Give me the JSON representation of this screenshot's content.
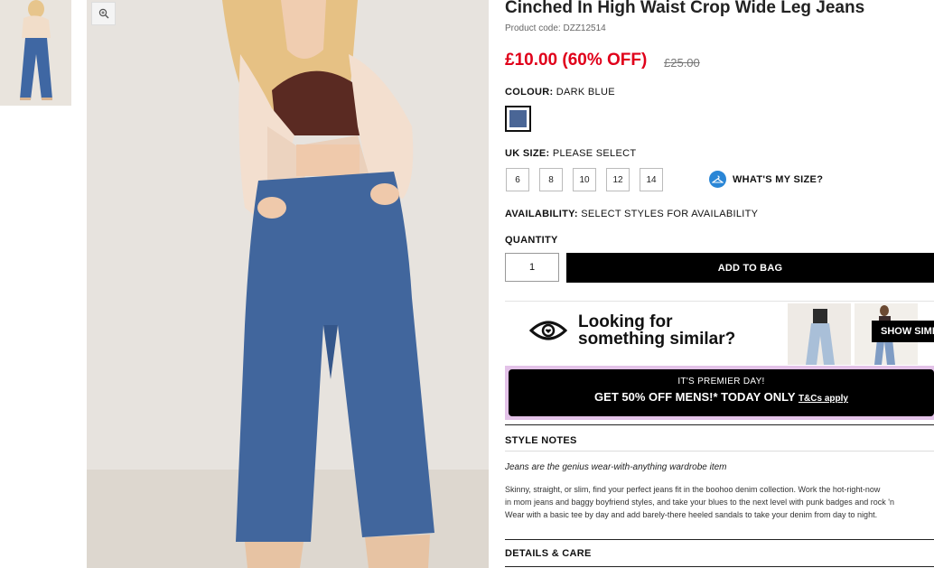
{
  "product": {
    "title": "Cinched In High Waist Crop Wide Leg Jeans",
    "code": "Product code: DZZ12514",
    "price": "£10.00 (60% OFF)",
    "old_price": "£25.00"
  },
  "colour": {
    "label": "COLOUR:",
    "value": "DARK BLUE",
    "swatch_color": "#4a6696"
  },
  "size": {
    "label": "UK SIZE:",
    "value": "PLEASE SELECT",
    "options": [
      "6",
      "8",
      "10",
      "12",
      "14"
    ],
    "guide_label": "WHAT'S MY SIZE?"
  },
  "availability": {
    "label": "AVAILABILITY:",
    "value": "SELECT STYLES FOR AVAILABILITY"
  },
  "quantity": {
    "label": "QUANTITY",
    "value": "1"
  },
  "add_to_bag": "ADD TO BAG",
  "similar": {
    "line1": "Looking for",
    "line2": "something similar?",
    "button": "SHOW SIMILAR"
  },
  "promo": {
    "line1": "IT'S PREMIER DAY!",
    "line2": "GET 50% OFF MENS!* TODAY ONLY",
    "tcs": "T&Cs apply",
    "border_color": "#e3c2e8"
  },
  "style_notes": {
    "heading": "STYLE NOTES",
    "tagline": "Jeans are the genius wear-with-anything wardrobe item",
    "body1": "Skinny, straight, or slim, find your perfect jeans fit in the boohoo denim collection. Work the hot-right-now",
    "body2": "in mom jeans and baggy boyfriend styles, and take your blues to the next level with punk badges and rock 'n",
    "body3": "Wear with a basic tee by day and add barely-there heeled sandals to take your denim from day to night."
  },
  "details": {
    "heading": "DETAILS & CARE"
  },
  "colors": {
    "sale_red": "#e0001a",
    "accent_blue": "#2a86d6"
  }
}
